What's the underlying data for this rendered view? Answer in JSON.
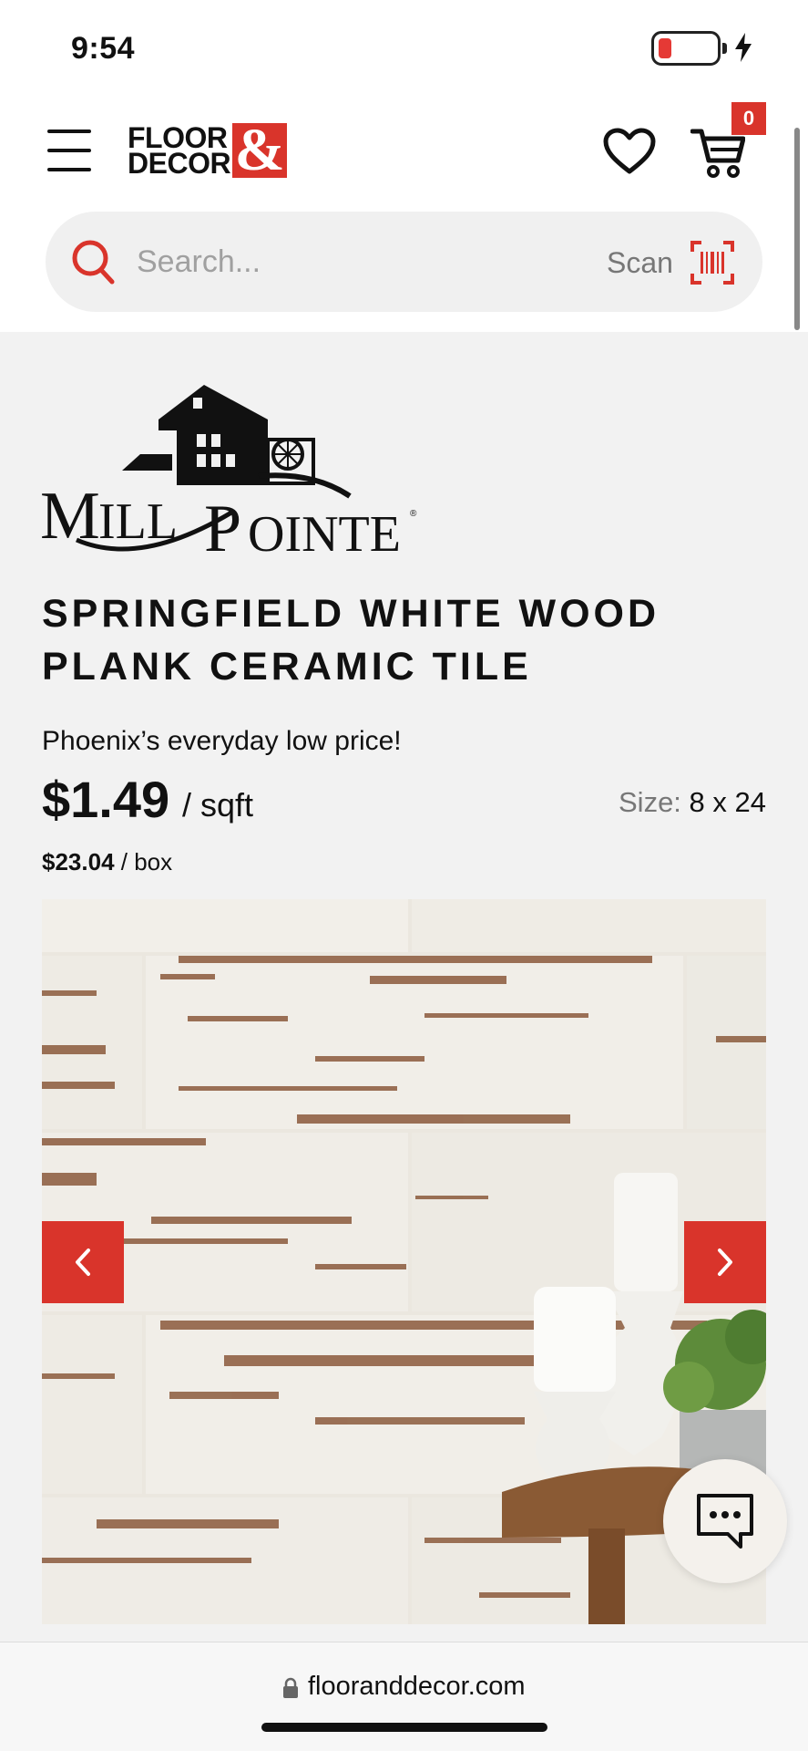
{
  "status_bar": {
    "time": "9:54"
  },
  "header": {
    "logo_line1": "FLOOR",
    "logo_line2": "DECOR",
    "logo_amp": "&",
    "cart_count": "0"
  },
  "search": {
    "placeholder": "Search...",
    "scan_label": "Scan"
  },
  "product": {
    "brand_logo_text": "MILL POINTE",
    "title_line1": "SPRINGFIELD WHITE WOOD",
    "title_line2": "PLANK CERAMIC TILE",
    "price_note": "Phoenix’s everyday low price!",
    "price": "$1.49",
    "price_unit": "/ sqft",
    "size_label": "Size:",
    "size_value": "8 x 24",
    "box_price": "$23.04",
    "box_unit": "/ box"
  },
  "browser": {
    "url": "flooranddecor.com"
  },
  "colors": {
    "brand_red": "#d9342b",
    "background": "#f2f2f2",
    "search_bg": "#f0f0f0"
  },
  "icons": [
    "menu-icon",
    "heart-icon",
    "cart-icon",
    "search-icon",
    "barcode-scan-icon",
    "chevron-left-icon",
    "chevron-right-icon",
    "chat-icon",
    "lock-icon",
    "battery-icon",
    "charging-bolt-icon"
  ]
}
